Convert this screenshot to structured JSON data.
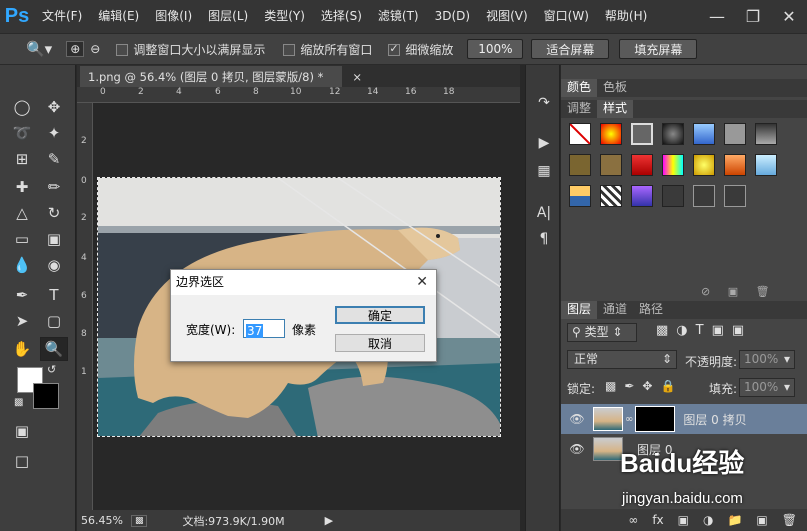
{
  "app": {
    "logo": "Ps"
  },
  "menu": [
    "文件(F)",
    "编辑(E)",
    "图像(I)",
    "图层(L)",
    "类型(Y)",
    "选择(S)",
    "滤镜(T)",
    "3D(D)",
    "视图(V)",
    "窗口(W)",
    "帮助(H)"
  ],
  "options": {
    "resize_windows": "调整窗口大小以满屏显示",
    "zoom_all": "缩放所有窗口",
    "scrubby_zoom": "细微缩放",
    "zoom_value": "100%",
    "fit_screen": "适合屏幕",
    "fill_screen": "填充屏幕"
  },
  "document": {
    "tab_title": "1.png @ 56.4% (图层 0 拷贝, 图层蒙版/8) *",
    "ruler_top": [
      "0",
      "2",
      "4",
      "6",
      "8",
      "10",
      "12",
      "14",
      "16",
      "18"
    ],
    "ruler_left": [
      "0",
      "2",
      "4",
      "6",
      "8",
      "1"
    ]
  },
  "status": {
    "zoom": "56.45%",
    "doc_size": "文档:973.9K/1.90M"
  },
  "dialog": {
    "title": "边界选区",
    "width_label": "宽度(W):",
    "width_value": "37",
    "unit": "像素",
    "ok": "确定",
    "cancel": "取消"
  },
  "panels": {
    "top_tabs": [
      "颜色",
      "色板"
    ],
    "style_tabs": [
      "调整",
      "样式"
    ],
    "layer_tabs": [
      "图层",
      "通道",
      "路径"
    ],
    "kind_filter": "类型",
    "blend_mode": "正常",
    "opacity_label": "不透明度:",
    "opacity_value": "100%",
    "lock_label": "锁定:",
    "fill_label": "填充:",
    "fill_value": "100%"
  },
  "layers": [
    {
      "name": "图层 0 拷贝",
      "selected": true
    },
    {
      "name": "图层 0",
      "selected": false
    }
  ],
  "watermark": {
    "brand": "Baidu经验",
    "url": "jingyan.baidu.com"
  }
}
